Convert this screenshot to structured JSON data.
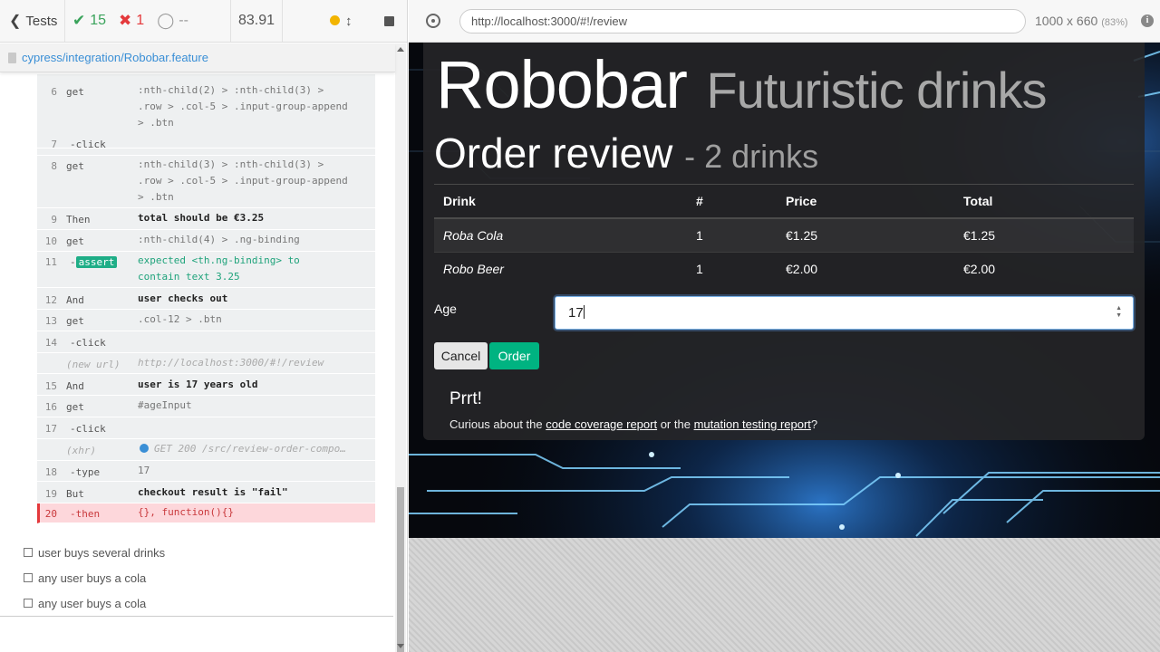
{
  "reporter": {
    "back_label": "Tests",
    "passed": "15",
    "failed": "1",
    "pending": "--",
    "duration": "83.91",
    "spec_path": "cypress/integration/Robobar.feature",
    "commands": [
      {
        "num": "6",
        "name": "get",
        "msg": ":nth-child(2) > :nth-child(3) >\n.row > .col-5 > .input-group-append\n> .btn"
      },
      {
        "num": "7",
        "name": "-click",
        "msg": ""
      },
      {
        "num": "8",
        "name": "get",
        "msg": ":nth-child(3) > :nth-child(3) >\n.row > .col-5 > .input-group-append\n> .btn"
      },
      {
        "num": "9",
        "name": "Then",
        "msg": "total should be €3.25"
      },
      {
        "num": "10",
        "name": "get",
        "msg": ":nth-child(4) > .ng-binding"
      },
      {
        "num": "11",
        "name": "-assert",
        "badge": "assert",
        "msg": "expected <th.ng-binding> to\ncontain text 3.25"
      },
      {
        "num": "12",
        "name": "And",
        "msg": "user checks out"
      },
      {
        "num": "13",
        "name": "get",
        "msg": ".col-12 > .btn"
      },
      {
        "num": "14",
        "name": "-click",
        "msg": ""
      },
      {
        "num": "",
        "name": "(new url)",
        "msg": "http://localhost:3000/#!/review"
      },
      {
        "num": "15",
        "name": "And",
        "msg": "user is 17 years old"
      },
      {
        "num": "16",
        "name": "get",
        "msg": "#ageInput"
      },
      {
        "num": "17",
        "name": "-click",
        "msg": ""
      },
      {
        "num": "",
        "name": "(xhr)",
        "msg": "GET 200 /src/review-order-compo…"
      },
      {
        "num": "18",
        "name": "-type",
        "msg": "17"
      },
      {
        "num": "19",
        "name": "But",
        "msg": "checkout result is \"fail\""
      },
      {
        "num": "20",
        "name": "-then",
        "msg": "{}, function(){}"
      }
    ],
    "tests": [
      "user buys several drinks",
      "any user buys a cola",
      "any user buys a cola"
    ]
  },
  "aut": {
    "url": "http://localhost:3000/#!/review",
    "viewport": "1000 x 660",
    "scale": "(83%)",
    "info_label": "i"
  },
  "page": {
    "brand": "Robobar",
    "tagline": "Futuristic drinks",
    "heading": "Order review",
    "drink_count": "- 2 drinks",
    "table": {
      "headers": [
        "Drink",
        "#",
        "Price",
        "Total"
      ],
      "rows": [
        [
          "Roba Cola",
          "1",
          "€1.25",
          "€1.25"
        ],
        [
          "Robo Beer",
          "1",
          "€2.00",
          "€2.00"
        ]
      ]
    },
    "age_label": "Age",
    "age_value": "17",
    "cancel_label": "Cancel",
    "order_label": "Order",
    "footer_title": "Prrt!",
    "footer_text_1": "Curious about the ",
    "footer_link_1": "code coverage report",
    "footer_text_2": " or the ",
    "footer_link_2": "mutation testing report",
    "footer_text_3": "?"
  },
  "colors": {
    "pass": "#3aa35b",
    "fail": "#e4393c",
    "order_button": "#00b381",
    "link": "#3a8fd6"
  }
}
